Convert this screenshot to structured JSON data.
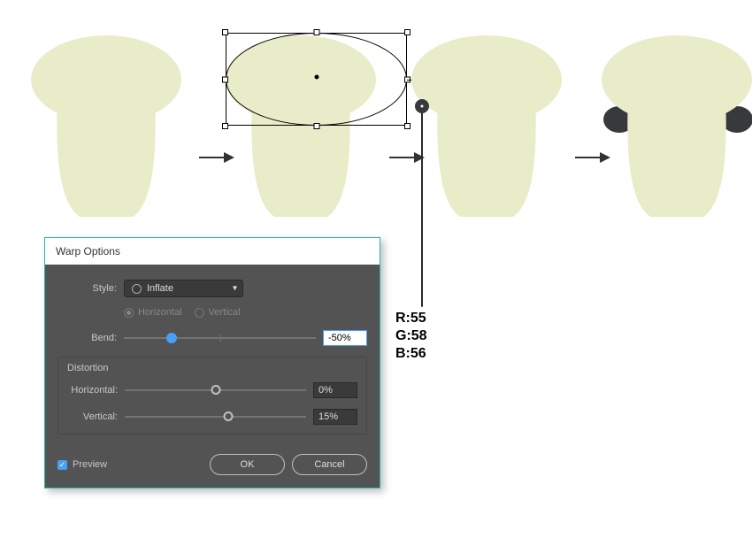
{
  "dialog": {
    "title": "Warp Options",
    "style_label": "Style:",
    "style_value": "Inflate",
    "orient_h": "Horizontal",
    "orient_v": "Vertical",
    "bend_label": "Bend:",
    "bend_value": "-50%",
    "distortion_title": "Distortion",
    "dh_label": "Horizontal:",
    "dh_value": "0%",
    "dv_label": "Vertical:",
    "dv_value": "15%",
    "preview_label": "Preview",
    "ok_label": "OK",
    "cancel_label": "Cancel"
  },
  "rgb": {
    "r": "R:55",
    "g": "G:58",
    "b": "B:56"
  },
  "colors": {
    "shape": "#e9ecc8",
    "ear": "#37393a",
    "accent": "#46a0f5"
  }
}
